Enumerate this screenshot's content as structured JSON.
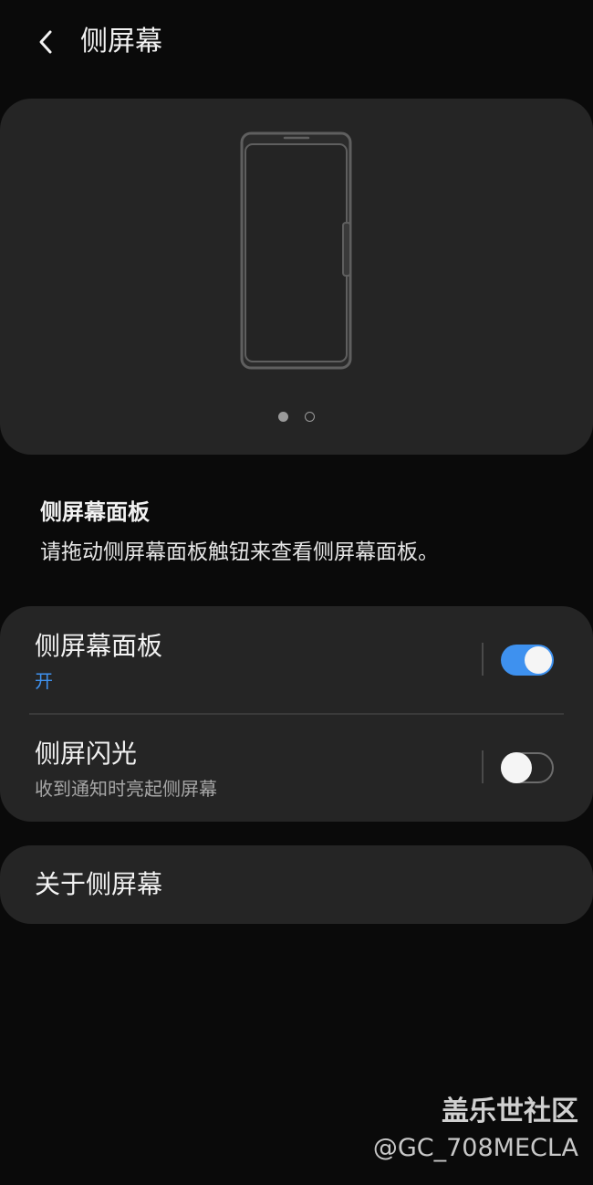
{
  "header": {
    "title": "侧屏幕"
  },
  "illustration": {
    "page_count": 2,
    "active_page": 1
  },
  "description": {
    "title": "侧屏幕面板",
    "text": "请拖动侧屏幕面板触钮来查看侧屏幕面板。"
  },
  "settings": [
    {
      "title": "侧屏幕面板",
      "subtitle": "开",
      "enabled": true
    },
    {
      "title": "侧屏闪光",
      "subtitle": "收到通知时亮起侧屏幕",
      "enabled": false
    }
  ],
  "about": {
    "label": "关于侧屏幕"
  },
  "watermark": {
    "title": "盖乐世社区",
    "handle": "@GC_708MECLA"
  },
  "colors": {
    "background": "#0a0a0a",
    "card": "#252525",
    "accent": "#3e91ef",
    "secondary_text": "#a6a6a6"
  }
}
